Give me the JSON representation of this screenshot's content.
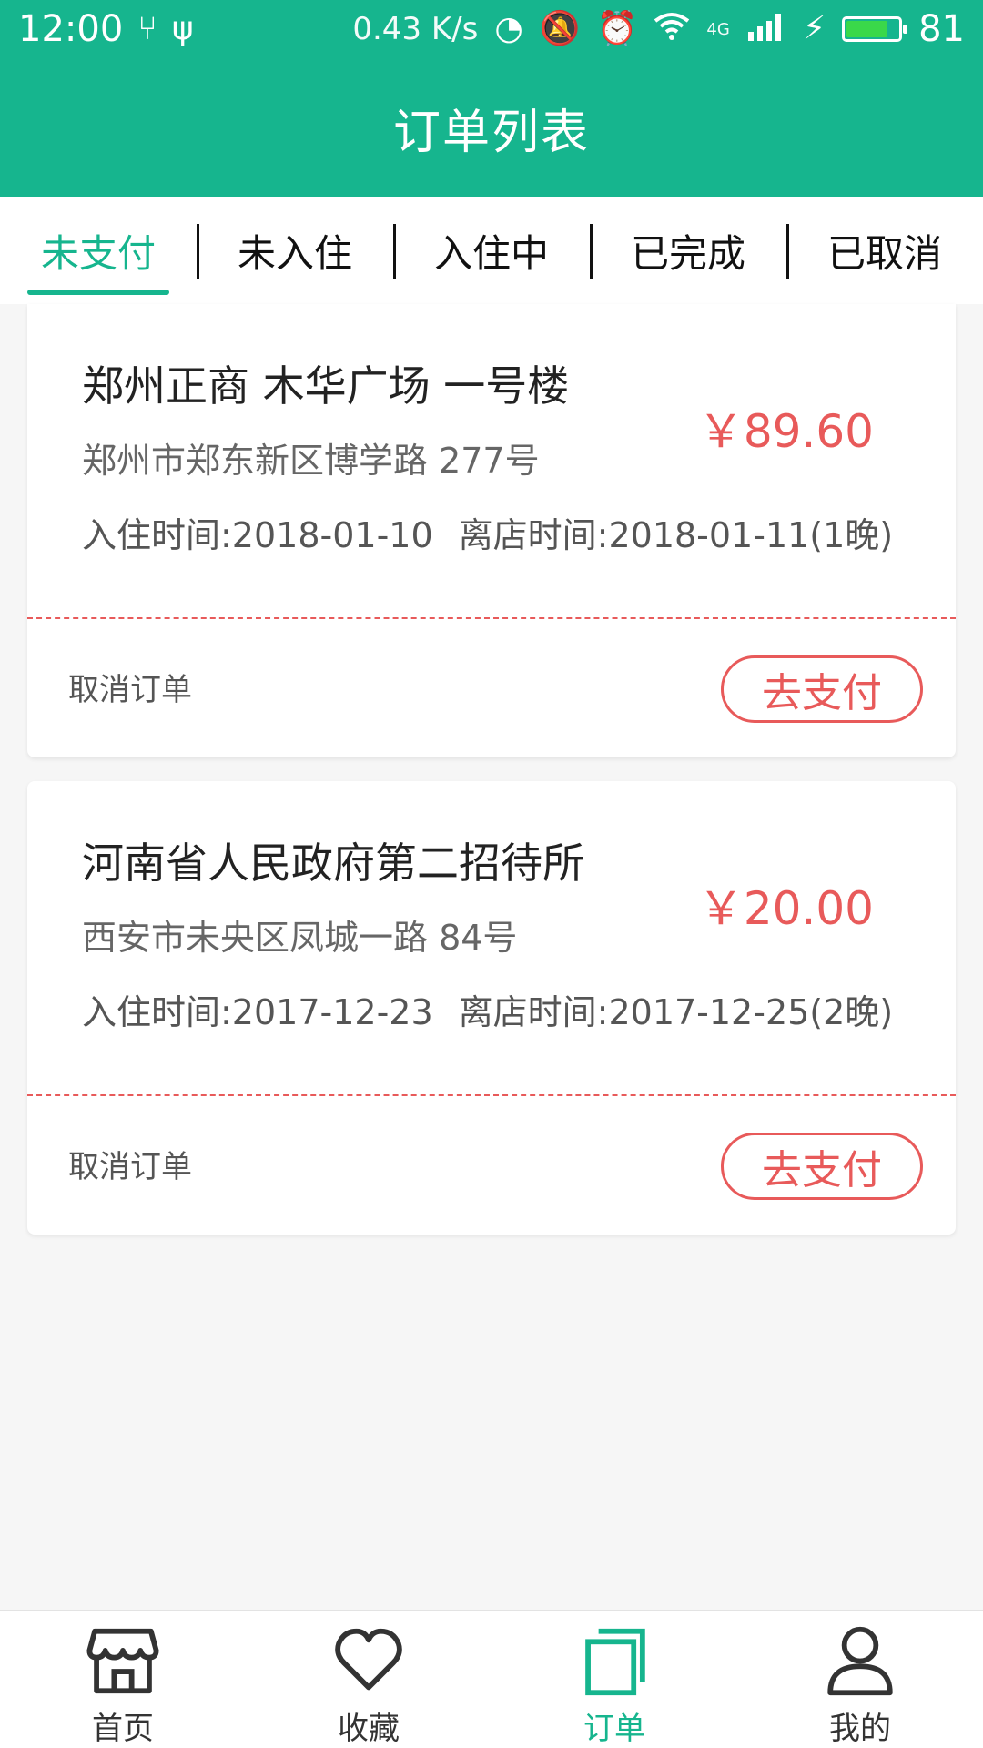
{
  "status_bar": {
    "time": "12:00",
    "speed": "0.43 K/s",
    "network": "4G",
    "battery_level": "81",
    "battery_fraction": 0.81
  },
  "header": {
    "title": "订单列表"
  },
  "tabs": [
    {
      "label": "未支付",
      "active": true
    },
    {
      "label": "未入住",
      "active": false
    },
    {
      "label": "入住中",
      "active": false
    },
    {
      "label": "已完成",
      "active": false
    },
    {
      "label": "已取消",
      "active": false
    }
  ],
  "orders": [
    {
      "hotel_name": "郑州正商 木华广场 一号楼",
      "address": "郑州市郑东新区博学路 277号",
      "checkin": "入住时间:2018-01-10",
      "checkout": "离店时间:2018-01-11(1晚)",
      "price": "￥89.60",
      "cancel_label": "取消订单",
      "pay_label": "去支付"
    },
    {
      "hotel_name": "河南省人民政府第二招待所",
      "address": "西安市未央区凤城一路 84号",
      "checkin": "入住时间:2017-12-23",
      "checkout": "离店时间:2017-12-25(2晚)",
      "price": "￥20.00",
      "cancel_label": "取消订单",
      "pay_label": "去支付"
    }
  ],
  "bottom_nav": [
    {
      "label": "首页",
      "icon": "store-icon",
      "active": false
    },
    {
      "label": "收藏",
      "icon": "heart-icon",
      "active": false
    },
    {
      "label": "订单",
      "icon": "orders-icon",
      "active": true
    },
    {
      "label": "我的",
      "icon": "user-icon",
      "active": false
    }
  ],
  "colors": {
    "brand_green": "#16b58e",
    "price_red": "#e85a5a",
    "battery_green": "#3ad84a"
  }
}
